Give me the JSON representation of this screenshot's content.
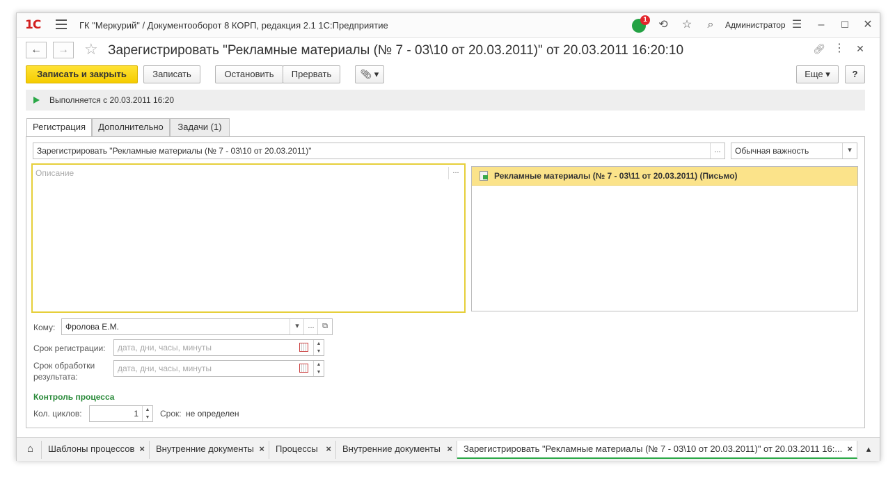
{
  "titlebar": {
    "logo": "1С",
    "title": "ГК \"Меркурий\" / Документооборот 8 КОРП, редакция 2.1 1С:Предприятие",
    "notifications_count": "1",
    "user": "Администратор"
  },
  "header": {
    "doc_title": "Зарегистрировать \"Рекламные материалы (№ 7 - 03\\10 от 20.03.2011)\" от 20.03.2011 16:20:10"
  },
  "toolbar": {
    "save_close": "Записать и закрыть",
    "save": "Записать",
    "stop": "Остановить",
    "abort": "Прервать",
    "more": "Еще",
    "help": "?"
  },
  "status": {
    "text": "Выполняется с 20.03.2011 16:20"
  },
  "tabs": [
    {
      "label": "Регистрация"
    },
    {
      "label": "Дополнительно"
    },
    {
      "label": "Задачи (1)"
    }
  ],
  "form": {
    "subject_value": "Зарегистрировать \"Рекламные материалы (№ 7 - 03\\10 от 20.03.2011)\"",
    "importance_value": "Обычная важность",
    "description_placeholder": "Описание",
    "linked_doc": "Рекламные материалы (№ 7 - 03\\11 от 20.03.2011) (Письмо)",
    "to_label": "Кому:",
    "to_value": "Фролова Е.М.",
    "reg_deadline_label": "Срок регистрации:",
    "date_placeholder": "дата, дни, часы, минуты",
    "result_deadline_label_1": "Срок обработки",
    "result_deadline_label_2": "результата:",
    "section_title": "Контроль процесса",
    "cycles_label": "Кол. циклов:",
    "cycles_value": "1",
    "deadline_label": "Срок:",
    "deadline_value": "не определен"
  },
  "bottom_tabs": [
    {
      "label": "Шаблоны процессов"
    },
    {
      "label": "Внутренние документы"
    },
    {
      "label": "Процессы"
    },
    {
      "label": "Внутренние документы"
    },
    {
      "label": "Зарегистрировать \"Рекламные материалы (№ 7 - 03\\10 от 20.03.2011)\" от 20.03.2011 16:..."
    }
  ],
  "colors": {
    "accent_yellow": "#f5cc00",
    "accent_green": "#2aa847",
    "badge_red": "#e3262c"
  }
}
